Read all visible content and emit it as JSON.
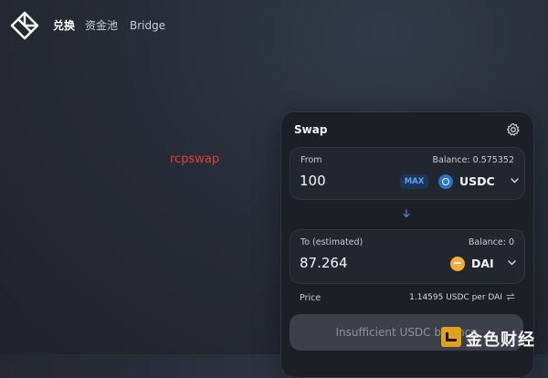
{
  "nav": {
    "links": [
      "兑换",
      "资金池",
      "Bridge"
    ]
  },
  "annotation": "rcpswap",
  "swap": {
    "title": "Swap",
    "from": {
      "label": "From",
      "balance": "Balance: 0.575352",
      "amount": "100",
      "max_label": "MAX",
      "token": "USDC",
      "token_icon": "usdc-icon"
    },
    "to": {
      "label": "To (estimated)",
      "balance": "Balance: 0",
      "amount": "87.264",
      "token": "DAI",
      "token_icon": "dai-icon"
    },
    "price": {
      "label": "Price",
      "value": "1.14595 USDC per DAI"
    },
    "action_button": "Insufficient USDC balance"
  },
  "watermark": "金色财经",
  "colors": {
    "accent": "#5aa2ff",
    "annotation": "#e0413a",
    "usdc": "#2775ca",
    "dai": "#f5ac37"
  }
}
